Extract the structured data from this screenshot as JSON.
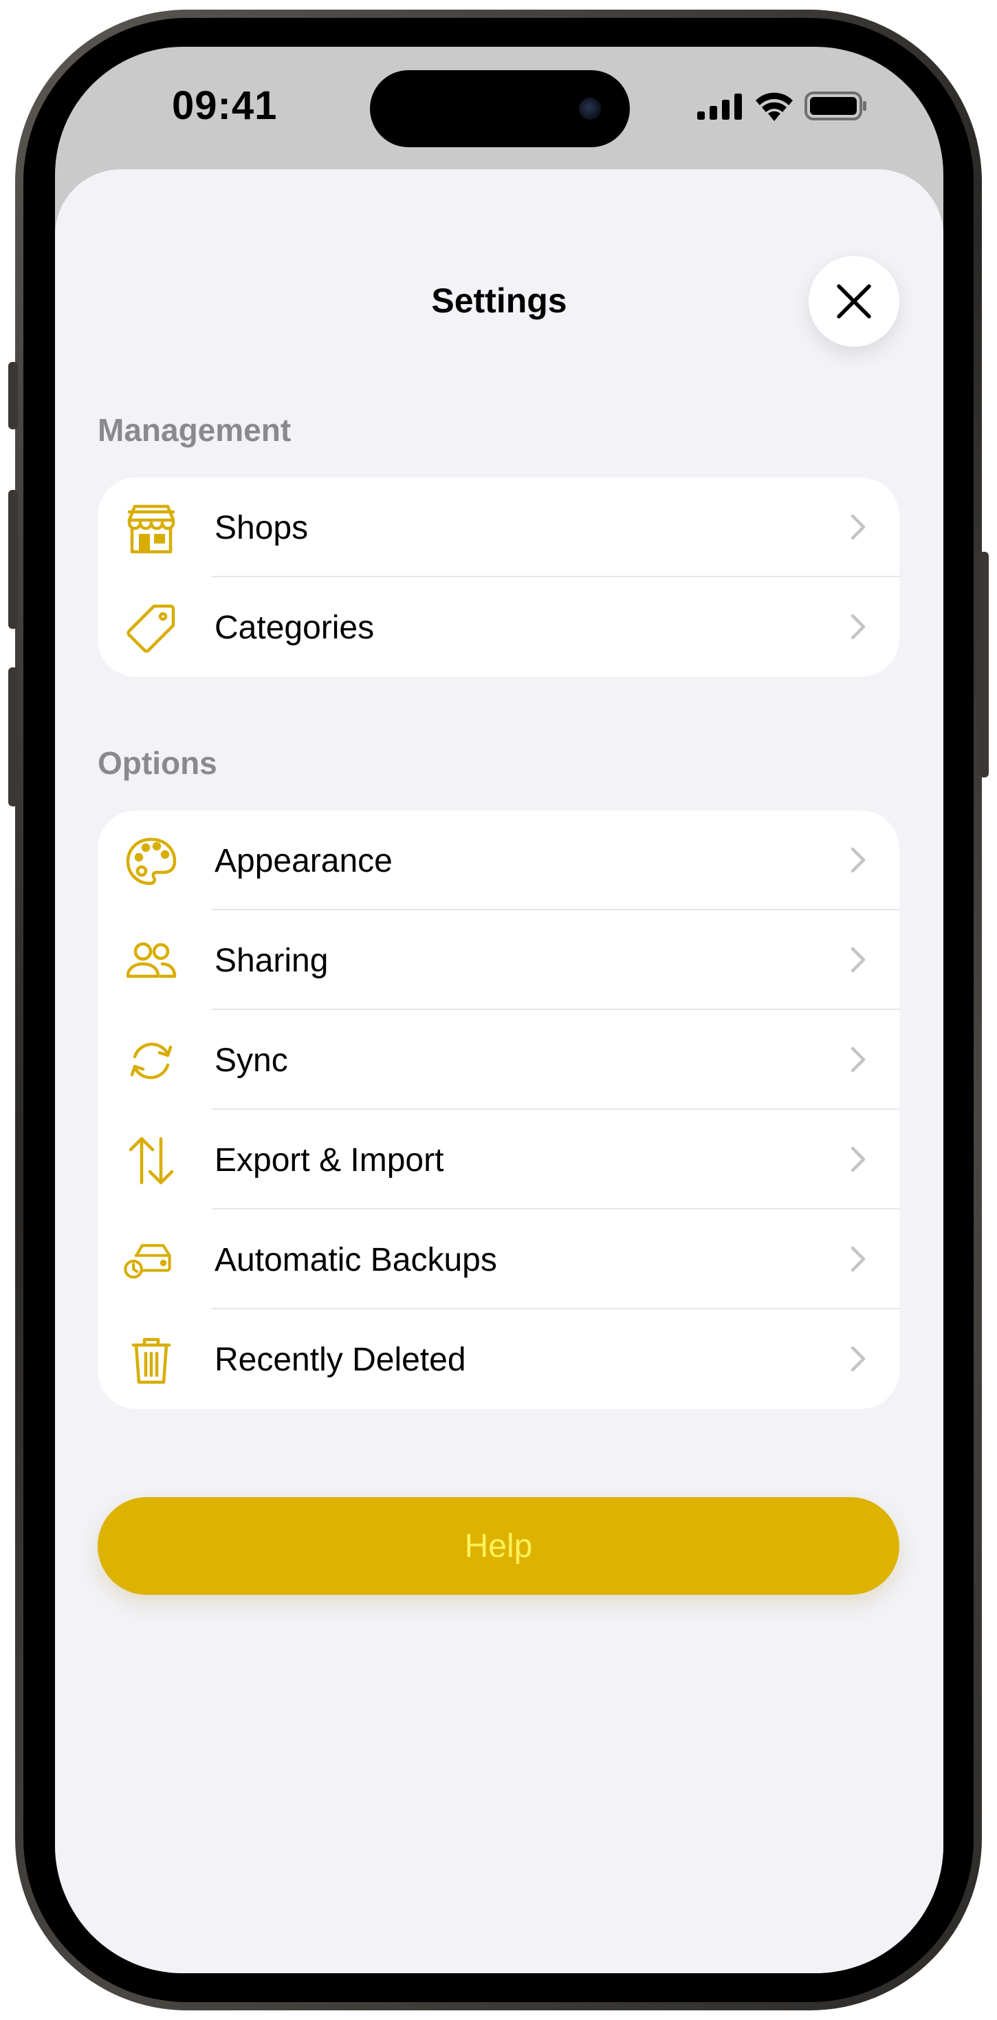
{
  "status_bar": {
    "time": "09:41"
  },
  "sheet": {
    "title": "Settings"
  },
  "colors": {
    "accent": "#ddb200",
    "icon": "#d8ad00",
    "background": "#f2f2f7",
    "section_header": "#8a8a8e",
    "help_text": "#fff15a"
  },
  "sections": [
    {
      "header": "Management",
      "items": [
        {
          "label": "Shops",
          "icon": "storefront-icon"
        },
        {
          "label": "Categories",
          "icon": "tag-icon"
        }
      ]
    },
    {
      "header": "Options",
      "items": [
        {
          "label": "Appearance",
          "icon": "palette-icon"
        },
        {
          "label": "Sharing",
          "icon": "people-icon"
        },
        {
          "label": "Sync",
          "icon": "sync-icon"
        },
        {
          "label": "Export & Import",
          "icon": "arrows-up-down-icon"
        },
        {
          "label": "Automatic Backups",
          "icon": "drive-clock-icon"
        },
        {
          "label": "Recently Deleted",
          "icon": "trash-icon"
        }
      ]
    }
  ],
  "help_button": {
    "label": "Help"
  }
}
